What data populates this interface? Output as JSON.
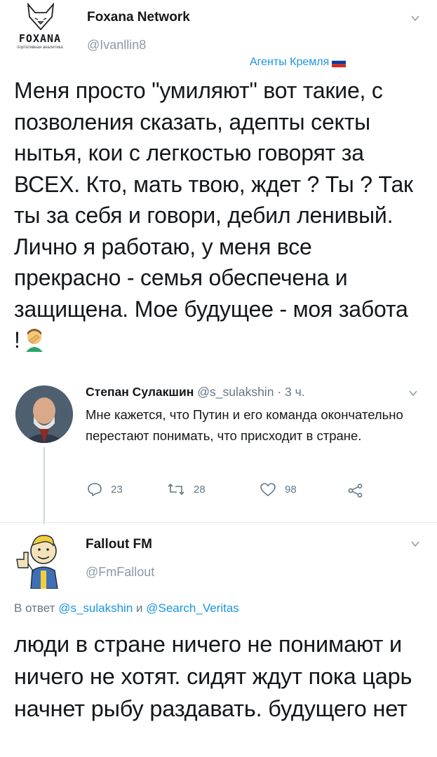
{
  "tweet1": {
    "display_name": "Foxana Network",
    "handle": "@Ivanllin8",
    "logo_text": "FOXANA",
    "logo_subtext": "портативная аналитика",
    "label": "Агенты Кремля",
    "text": "Меня просто \"умиляют\" вот такие, с позволения сказать, адепты секты нытья, кои с легкостью говорят за ВСЕХ. Кто, мать твою, ждет ? Ты ? Так ты за себя и говори, дебил ленивый. Лично я работаю, у меня все прекрасно - семья обеспечена и защищена. Мое будущее - моя забота !"
  },
  "quoted": {
    "display_name": "Степан Сулакшин",
    "handle": "@s_sulakshin",
    "separator": "·",
    "time": "3 ч.",
    "text": "Мне кажется, что Путин и его команда окончательно перестают понимать, что присходит в стране.",
    "replies": "23",
    "retweets": "28",
    "likes": "98"
  },
  "tweet2": {
    "display_name": "Fallout FM",
    "handle": "@FmFallout",
    "reply_prefix": "В ответ",
    "reply_to_1": "@s_sulakshin",
    "reply_and": "и",
    "reply_to_2": "@Search_Veritas",
    "text": "люди в стране ничего не понимают и ничего не хотят. сидят ждут пока царь начнет рыбу раздавать. будущего нет"
  },
  "colors": {
    "link": "#1b95e0",
    "meta": "#657786",
    "text": "#14171a"
  }
}
